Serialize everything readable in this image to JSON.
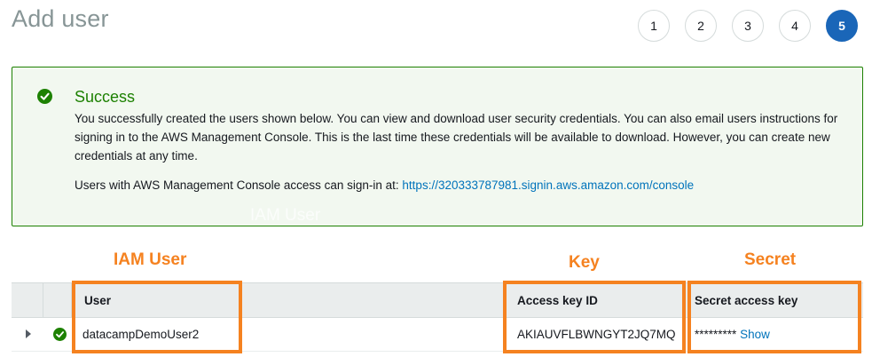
{
  "page": {
    "title": "Add user"
  },
  "steps": [
    "1",
    "2",
    "3",
    "4",
    "5"
  ],
  "active_step": "5",
  "alert": {
    "title": "Success",
    "body": "You successfully created the users shown below. You can view and download user security credentials. You can also email users instructions for signing in to the AWS Management Console. This is the last time these credentials will be available to download. However, you can create new credentials at any time.",
    "signin_prefix": "Users with AWS Management Console access can sign-in at: ",
    "signin_url": "https://320333787981.signin.aws.amazon.com/console",
    "ghost_text": "IAM User"
  },
  "annotations": {
    "iam_user": "IAM User",
    "key": "Key",
    "secret": "Secret",
    "highlight_color": "#f58220"
  },
  "table": {
    "columns": {
      "user": "User",
      "access_key": "Access key ID",
      "secret_key": "Secret access key"
    },
    "rows": [
      {
        "user": "datacampDemoUser2",
        "access_key": "AKIAUVFLBWNGYT2JQ7MQ",
        "secret_masked": "*********",
        "show_label": "Show"
      }
    ]
  },
  "colors": {
    "success": "#1d8102",
    "link": "#0073bb",
    "active_step": "#1a66b8"
  },
  "icons": {
    "success": "check-circle-icon",
    "expand": "caret-right-icon"
  }
}
